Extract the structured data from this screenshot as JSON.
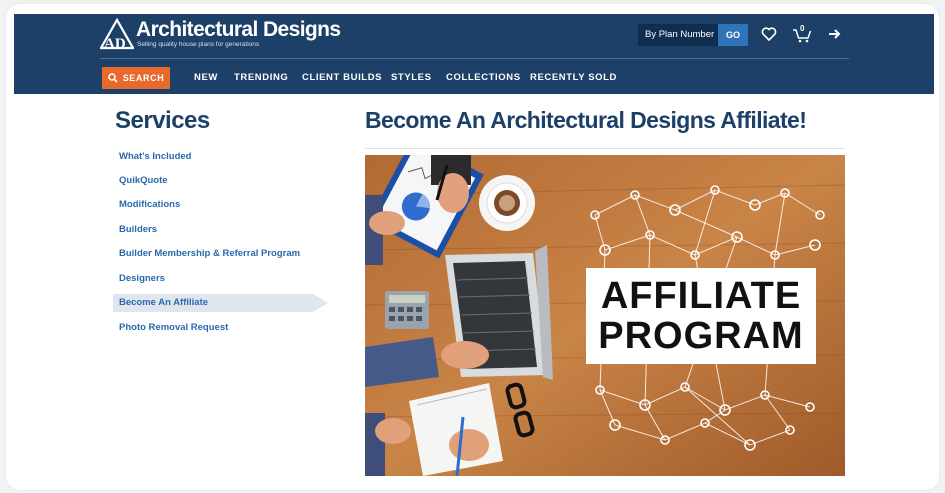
{
  "header": {
    "logo_title": "Architectural Designs",
    "logo_tagline": "Selling quality house plans for generations",
    "plan_search": {
      "placeholder": "By Plan Number",
      "go_label": "GO"
    },
    "icons": [
      "heart-icon",
      "cart-icon",
      "login-icon"
    ],
    "cart_count": "0",
    "colors": {
      "bar": "#1d4068",
      "search_button": "#e8692c",
      "go_button": "#2f73b8"
    }
  },
  "nav": {
    "search_label": "SEARCH",
    "items": [
      "NEW",
      "TRENDING",
      "CLIENT BUILDS",
      "STYLES",
      "COLLECTIONS",
      "RECENTLY SOLD"
    ]
  },
  "sidebar": {
    "title": "Services",
    "items": [
      "What's Included",
      "QuikQuote",
      "Modifications",
      "Builders",
      "Builder Membership & Referral Program",
      "Designers",
      "Become An Affiliate",
      "Photo Removal Request"
    ],
    "active_item": "Become An Affiliate"
  },
  "main": {
    "title": "Become An Architectural Designs Affiliate!",
    "hero": {
      "line1": "AFFILIATE",
      "line2": "PROGRAM"
    }
  }
}
